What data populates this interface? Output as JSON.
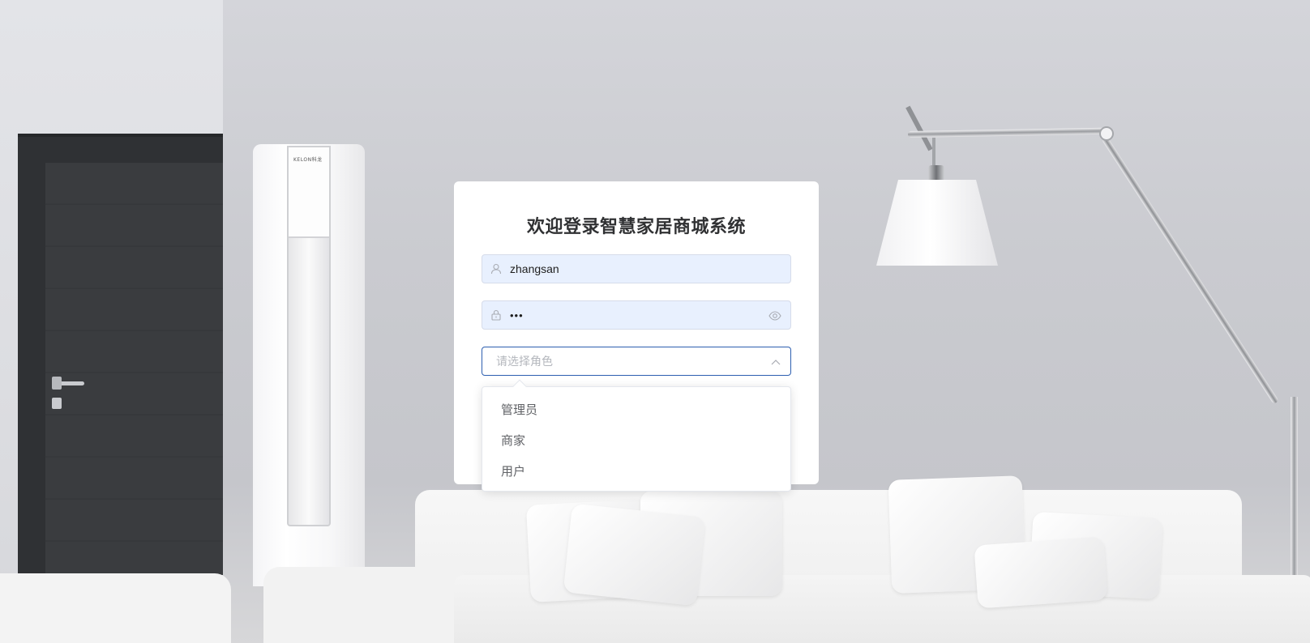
{
  "login": {
    "title": "欢迎登录智慧家居商城系统",
    "username_value": "zhangsan",
    "password_value": "•••",
    "role_placeholder": "请选择角色"
  },
  "role_dropdown": {
    "options": [
      "管理员",
      "商家",
      "用户"
    ]
  },
  "background": {
    "ac_brand": "KELON科龙"
  },
  "icons": {
    "username": "user-icon",
    "password": "lock-icon",
    "visibility": "eye-icon",
    "dropdown": "chevron-up-icon"
  },
  "colors": {
    "input_fill": "#e8f0fe",
    "select_border": "#2d5fb0",
    "title_text": "#303133",
    "option_text": "#606266"
  }
}
